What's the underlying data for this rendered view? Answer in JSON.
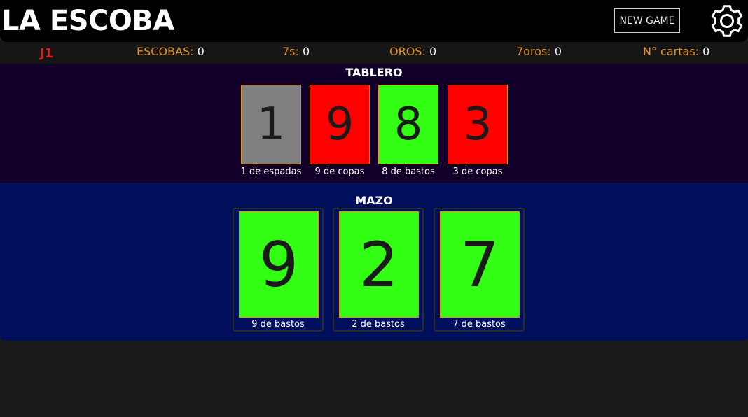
{
  "header": {
    "title": "LA ESCOBA",
    "new_game_label": "NEW GAME",
    "settings_icon": "gear-icon"
  },
  "scoreboard": {
    "player": "J1",
    "escobas": {
      "label": "ESCOBAS:",
      "value": "0"
    },
    "sietes": {
      "label": "7s:",
      "value": "0"
    },
    "oros": {
      "label": "OROS:",
      "value": "0"
    },
    "siete_oros": {
      "label": "7oros:",
      "value": "0"
    },
    "num_cartas": {
      "label": "N° cartas:",
      "value": "0"
    }
  },
  "tablero": {
    "title": "TABLERO",
    "cards": [
      {
        "number": "1",
        "caption": "1 de espadas",
        "color": "#808080"
      },
      {
        "number": "9",
        "caption": "9 de copas",
        "color": "#ff0000"
      },
      {
        "number": "8",
        "caption": "8 de bastos",
        "color": "#33ff14"
      },
      {
        "number": "3",
        "caption": "3 de copas",
        "color": "#ff0000"
      }
    ]
  },
  "mazo": {
    "title": "MAZO",
    "cards": [
      {
        "number": "9",
        "caption": "9 de bastos",
        "color": "#33ff14"
      },
      {
        "number": "2",
        "caption": "2 de bastos",
        "color": "#33ff14"
      },
      {
        "number": "7",
        "caption": "7 de bastos",
        "color": "#33ff14"
      }
    ]
  },
  "colors": {
    "label_orange": "#e69128",
    "player_red": "#e01b1b",
    "tablero_bg": "#12002b",
    "mazo_bg": "#000f5c",
    "card_border": "#e69128"
  }
}
